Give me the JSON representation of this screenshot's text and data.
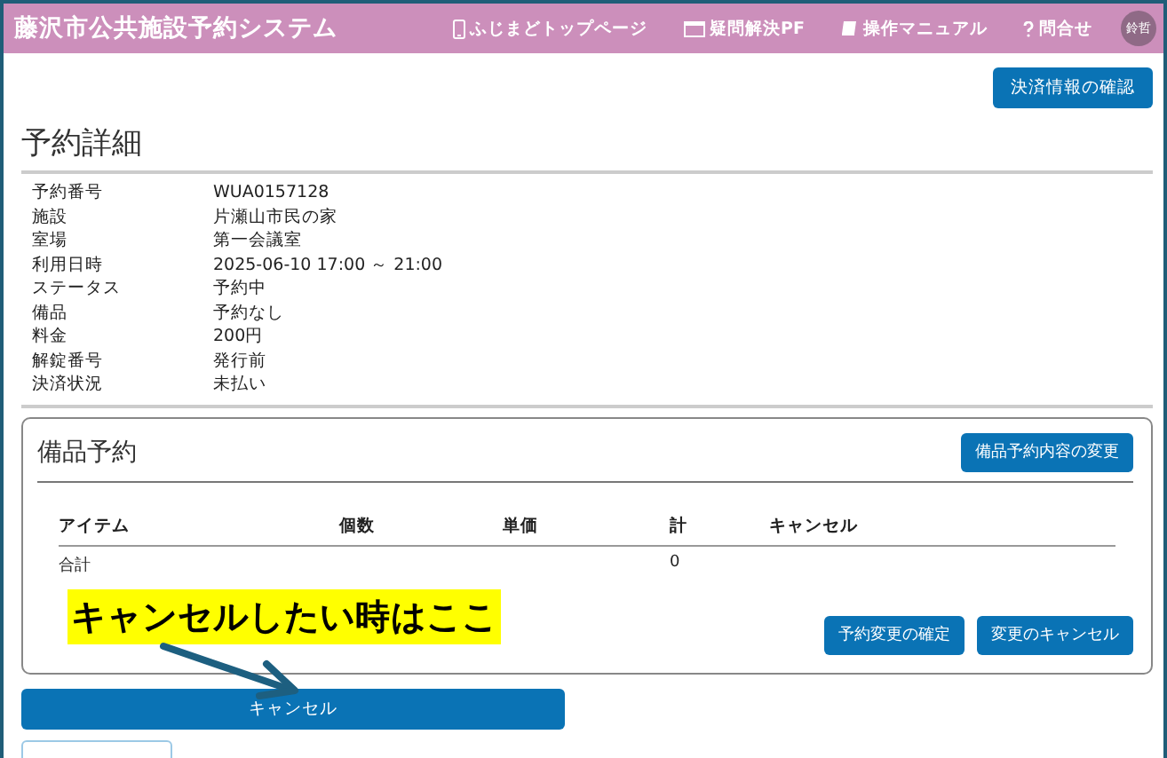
{
  "header": {
    "title": "藤沢市公共施設予約システム",
    "nav": [
      {
        "kind": "phone",
        "label": "ふじまどトップページ"
      },
      {
        "kind": "screen",
        "label": "疑問解決PF"
      },
      {
        "kind": "book",
        "label": "操作マニュアル"
      },
      {
        "kind": "question",
        "label": "問合せ"
      }
    ],
    "avatar": "鈴哲"
  },
  "payment_button": "決済情報の確認",
  "details": {
    "title": "予約詳細",
    "rows": [
      {
        "label": "予約番号",
        "value": "WUA0157128"
      },
      {
        "label": "施設",
        "value": "片瀬山市民の家"
      },
      {
        "label": "室場",
        "value": "第一会議室"
      },
      {
        "label": "利用日時",
        "value": "2025-06-10 17:00 ～ 21:00"
      },
      {
        "label": "ステータス",
        "value": "予約中"
      },
      {
        "label": "備品",
        "value": "予約なし"
      },
      {
        "label": "料金",
        "value": "200円"
      },
      {
        "label": "解錠番号",
        "value": "発行前"
      },
      {
        "label": "決済状況",
        "value": "未払い"
      }
    ]
  },
  "equipment": {
    "title": "備品予約",
    "change_button": "備品予約内容の変更",
    "table": {
      "columns": [
        "アイテム",
        "個数",
        "単価",
        "計",
        "キャンセル"
      ],
      "rows": [
        [
          "合計",
          "",
          "",
          "0",
          ""
        ]
      ]
    },
    "buttons": [
      "予約変更の確定",
      "変更のキャンセル"
    ]
  },
  "callout": "キャンセルしたい時はここ",
  "cancel_button": "キャンセル"
}
